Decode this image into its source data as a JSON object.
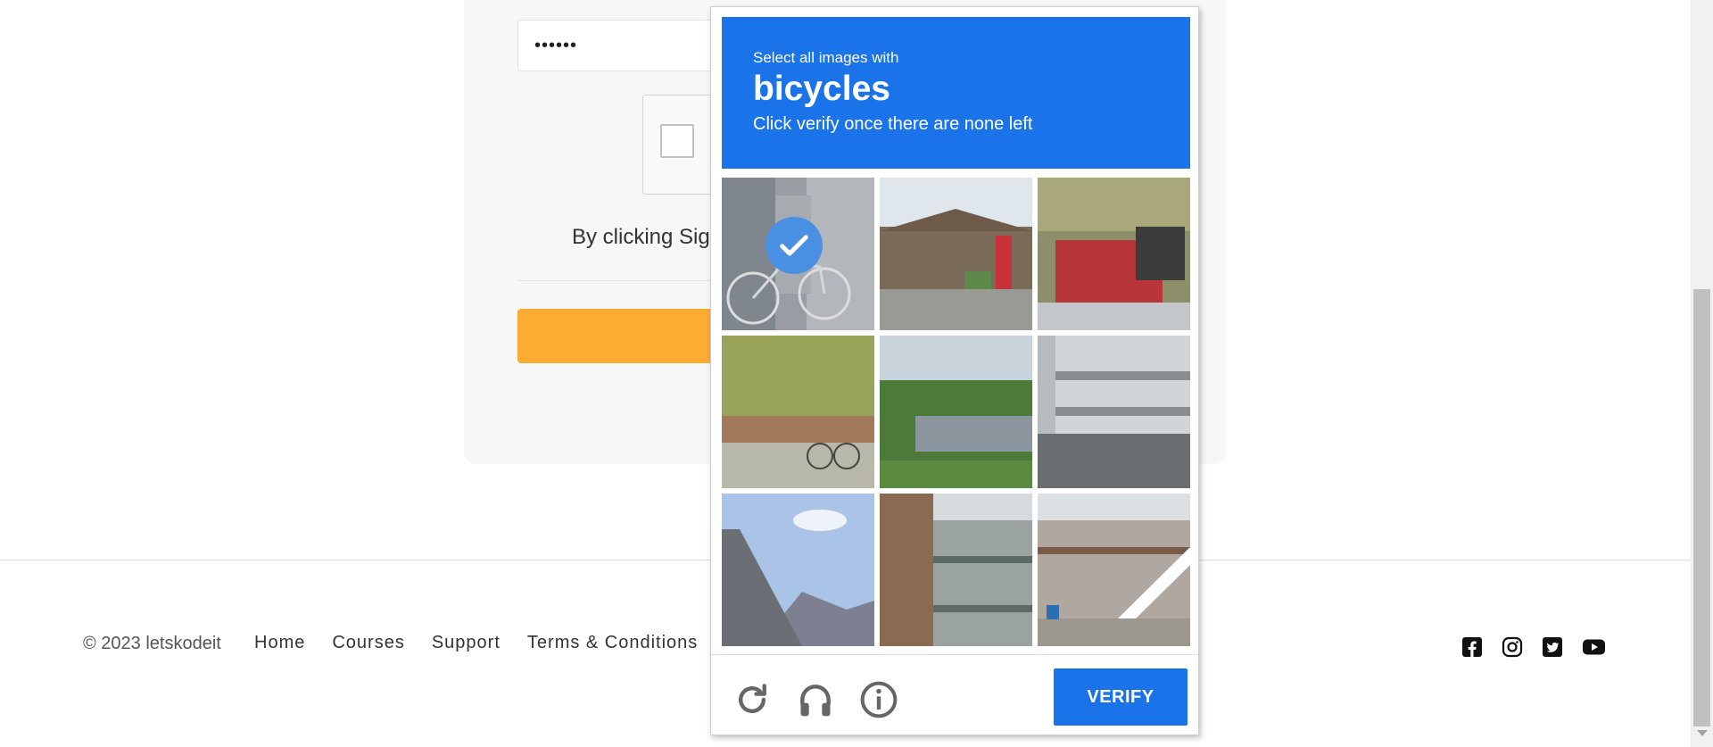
{
  "login_form": {
    "password_value": "••••••",
    "terms_text": "By clicking Sign"
  },
  "footer": {
    "copyright": "© 2023 letskodeit",
    "links": [
      "Home",
      "Courses",
      "Support",
      "Terms & Conditions"
    ],
    "social_icons": [
      "facebook-icon",
      "instagram-icon",
      "twitter-icon",
      "youtube-icon"
    ]
  },
  "captcha": {
    "instruction_line1": "Select all images with",
    "target_object": "bicycles",
    "instruction_line2": "Click verify once there are none left",
    "tiles_selected": [
      true,
      false,
      false,
      false,
      false,
      false,
      false,
      false,
      false
    ],
    "buttons": {
      "reload": "reload-icon",
      "audio": "headphones-icon",
      "info": "info-icon",
      "verify": "VERIFY"
    },
    "colors": {
      "accent": "#1a73e8",
      "selected_check": "#4a90e2"
    }
  },
  "colors": {
    "signup_button": "#fdab33"
  }
}
